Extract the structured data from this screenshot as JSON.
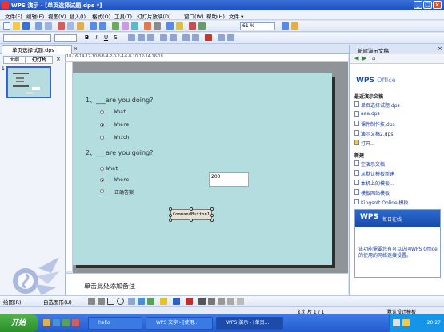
{
  "window": {
    "title": "WPS 演示 - [单页选择试题.dps *]"
  },
  "menu": [
    "文件(F)",
    "编辑(E)",
    "视图(V)",
    "插入(I)",
    "格式(O)",
    "工具(T)",
    "幻灯片放映(D)",
    "窗口(W)",
    "帮助(H)",
    "文件 ▾"
  ],
  "toolbar": {
    "zoom": "61 %",
    "font": "",
    "size": ""
  },
  "doc_tab": {
    "label": "单页选择试题.dps"
  },
  "left_tabs": [
    "大纲",
    "幻灯片"
  ],
  "slide_number": "1",
  "ruler_text": "18·16·14·12·10·8·6·4·2·0·2·4·6·8·10·12·14·16·18",
  "slide": {
    "q1": "1、___are you doing?",
    "q1_options": [
      "What",
      "Where",
      "Which"
    ],
    "q1_selected": 1,
    "q2": "2、___are you going?",
    "q2_options": [
      "What",
      "Where",
      "正确答案"
    ],
    "q2_selected": 1,
    "textbox_value": "200",
    "button_label": "CommandButton1"
  },
  "notes": {
    "placeholder": "单击此处添加备注"
  },
  "taskpane": {
    "header": "新建演示文稿",
    "logo": "WPS",
    "logo_suffix": "Office",
    "recent_title": "最近演示文稿",
    "recent": [
      "单页选择试题.dps",
      "aaa.dps",
      "课件制作技.dps",
      "演示文稿2.dps"
    ],
    "open_more": "打开...",
    "new_title": "新建",
    "new_items": [
      "空演示文稿",
      "从默认模板新建",
      "本机上的模板...",
      "模板网站模板",
      "Kingsoft Online 模板"
    ],
    "online_title": "WPS",
    "online_sub": "每日在线",
    "online_text": "该功能需要您有可以访问WPS Office的使用的网络连接设置。"
  },
  "drawbar": {
    "draw_label": "绘图(R)",
    "autoshape_label": "自选图形(U)"
  },
  "status": {
    "slide": "幻灯片 1 / 1",
    "design": "默认设计模板"
  },
  "taskbar": {
    "start": "开始",
    "items": [
      "hello",
      "WPS 文字 - [使用...",
      "WPS 演示 - [单页..."
    ],
    "time": "20:27"
  }
}
